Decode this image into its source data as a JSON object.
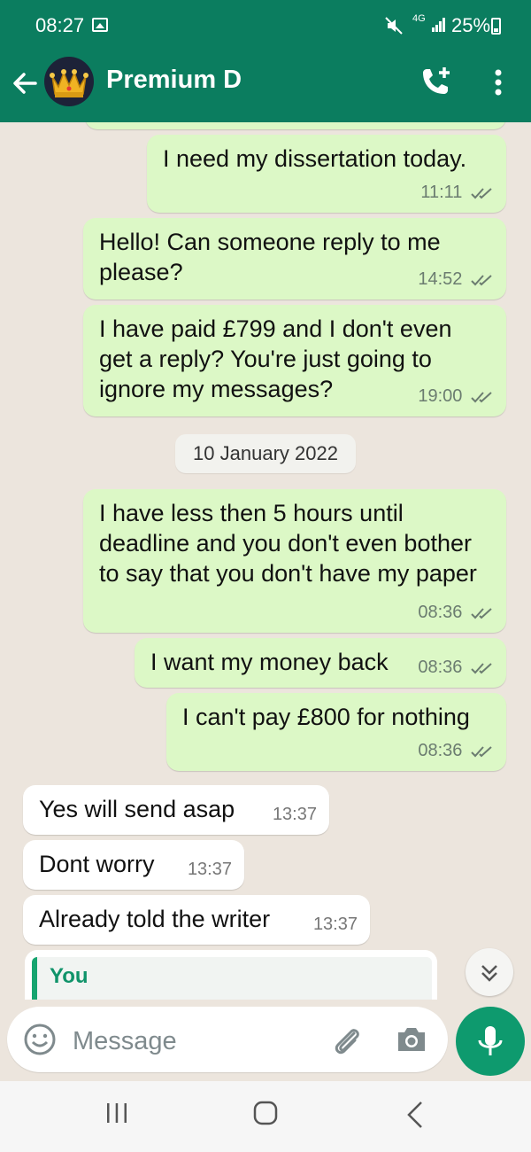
{
  "status_bar": {
    "time": "08:27",
    "network": "4G",
    "battery": "25%"
  },
  "header": {
    "contact_name": "Premium D"
  },
  "messages": [
    {
      "direction": "out",
      "text": "I need my dissertation today.",
      "time": "11:11"
    },
    {
      "direction": "out",
      "text": "Hello! Can someone reply to me please?",
      "time": "14:52"
    },
    {
      "direction": "out",
      "text": "I have paid £799 and I don't even get a reply? You're just going to ignore my messages?",
      "time": "19:00"
    },
    {
      "direction": "out",
      "text": "I have less then 5 hours until deadline and you don't even bother to say that you don't have my paper",
      "time": "08:36"
    },
    {
      "direction": "out",
      "text": "I want my money back",
      "time": "08:36"
    },
    {
      "direction": "out",
      "text": "I can't pay £800 for nothing",
      "time": "08:36"
    },
    {
      "direction": "in",
      "text": "Yes will send asap",
      "time": "13:37"
    },
    {
      "direction": "in",
      "text": "Dont worry",
      "time": "13:37"
    },
    {
      "direction": "in",
      "text": "Already told the writer",
      "time": "13:37"
    }
  ],
  "date_separator": "10 January 2022",
  "reply_preview": {
    "author": "You"
  },
  "input": {
    "placeholder": "Message"
  },
  "colors": {
    "header": "#0b7d5f",
    "outgoing_bubble": "#dcf8c6",
    "incoming_bubble": "#ffffff",
    "tick": "#6b7c70",
    "mic_button": "#0e9a6e"
  }
}
